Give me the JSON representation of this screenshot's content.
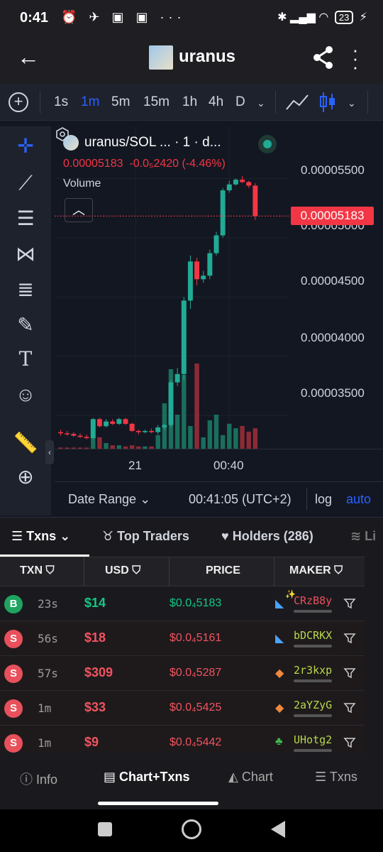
{
  "status_bar": {
    "time": "0:41",
    "battery": "23",
    "left_icons": "⏰ ✈ ▣ ▣ ···"
  },
  "header": {
    "title": "uranus"
  },
  "timeframes": {
    "items": [
      "1s",
      "1m",
      "5m",
      "15m",
      "1h",
      "4h",
      "D"
    ],
    "active": "1m"
  },
  "chart_legend": {
    "symbol": "uranus/SOL ... · 1 · d...",
    "last_price": "0.00005183",
    "change": "-0.0₅2420 (-4.46%)",
    "volume_label": "Volume"
  },
  "chart_data": {
    "type": "candlestick",
    "y_ticks": [
      "0.00005500",
      "0.00005000",
      "0.00004500",
      "0.00004000",
      "0.00003500"
    ],
    "y_range": [
      3.22e-05,
      5.7e-05
    ],
    "price_tag": "0.00005183",
    "x_ticks": [
      "21",
      "00:40"
    ],
    "candles": [
      {
        "o": 3.36e-05,
        "h": 3.38e-05,
        "l": 3.33e-05,
        "c": 3.35e-05,
        "v": 1
      },
      {
        "o": 3.35e-05,
        "h": 3.37e-05,
        "l": 3.33e-05,
        "c": 3.345e-05,
        "v": 1
      },
      {
        "o": 3.345e-05,
        "h": 3.36e-05,
        "l": 3.32e-05,
        "c": 3.33e-05,
        "v": 1
      },
      {
        "o": 3.33e-05,
        "h": 3.35e-05,
        "l": 3.31e-05,
        "c": 3.32e-05,
        "v": 1
      },
      {
        "o": 3.32e-05,
        "h": 3.34e-05,
        "l": 3.3e-05,
        "c": 3.31e-05,
        "v": 1
      },
      {
        "o": 3.31e-05,
        "h": 3.48e-05,
        "l": 3.3e-05,
        "c": 3.47e-05,
        "v": 25
      },
      {
        "o": 3.47e-05,
        "h": 3.48e-05,
        "l": 3.4e-05,
        "c": 3.41e-05,
        "v": 10
      },
      {
        "o": 3.41e-05,
        "h": 3.47e-05,
        "l": 3.4e-05,
        "c": 3.45e-05,
        "v": 5
      },
      {
        "o": 3.45e-05,
        "h": 3.47e-05,
        "l": 3.42e-05,
        "c": 3.43e-05,
        "v": 3
      },
      {
        "o": 3.43e-05,
        "h": 3.48e-05,
        "l": 3.42e-05,
        "c": 3.47e-05,
        "v": 3
      },
      {
        "o": 3.47e-05,
        "h": 3.48e-05,
        "l": 3.42e-05,
        "c": 3.43e-05,
        "v": 2
      },
      {
        "o": 3.43e-05,
        "h": 3.44e-05,
        "l": 3.36e-05,
        "c": 3.37e-05,
        "v": 3
      },
      {
        "o": 3.37e-05,
        "h": 3.38e-05,
        "l": 3.34e-05,
        "c": 3.36e-05,
        "v": 2
      },
      {
        "o": 3.36e-05,
        "h": 3.38e-05,
        "l": 3.35e-05,
        "c": 3.37e-05,
        "v": 2
      },
      {
        "o": 3.37e-05,
        "h": 3.39e-05,
        "l": 3.35e-05,
        "c": 3.36e-05,
        "v": 2
      },
      {
        "o": 3.36e-05,
        "h": 3.42e-05,
        "l": 3.34e-05,
        "c": 3.4e-05,
        "v": 12
      },
      {
        "o": 3.4e-05,
        "h": 3.43e-05,
        "l": 3.38e-05,
        "c": 3.42e-05,
        "v": 40
      },
      {
        "o": 3.42e-05,
        "h": 3.8e-05,
        "l": 3.4e-05,
        "c": 3.78e-05,
        "v": 70
      },
      {
        "o": 3.78e-05,
        "h": 3.9e-05,
        "l": 3.75e-05,
        "c": 3.85e-05,
        "v": 30
      },
      {
        "o": 3.85e-05,
        "h": 4.5e-05,
        "l": 3.8e-05,
        "c": 4.47e-05,
        "v": 65
      },
      {
        "o": 4.47e-05,
        "h": 4.85e-05,
        "l": 4.4e-05,
        "c": 4.8e-05,
        "v": 20
      },
      {
        "o": 4.8e-05,
        "h": 4.83e-05,
        "l": 4.6e-05,
        "c": 4.65e-05,
        "v": 75
      },
      {
        "o": 4.65e-05,
        "h": 4.72e-05,
        "l": 4.62e-05,
        "c": 4.68e-05,
        "v": 10
      },
      {
        "o": 4.68e-05,
        "h": 4.9e-05,
        "l": 4.65e-05,
        "c": 4.87e-05,
        "v": 25
      },
      {
        "o": 4.87e-05,
        "h": 5.05e-05,
        "l": 4.85e-05,
        "c": 5.02e-05,
        "v": 30
      },
      {
        "o": 5.02e-05,
        "h": 5.42e-05,
        "l": 5e-05,
        "c": 5.4e-05,
        "v": 12
      },
      {
        "o": 5.4e-05,
        "h": 5.48e-05,
        "l": 5.38e-05,
        "c": 5.45e-05,
        "v": 22
      },
      {
        "o": 5.45e-05,
        "h": 5.5e-05,
        "l": 5.44e-05,
        "c": 5.49e-05,
        "v": 18
      },
      {
        "o": 5.49e-05,
        "h": 5.52e-05,
        "l": 5.46e-05,
        "c": 5.47e-05,
        "v": 20
      },
      {
        "o": 5.47e-05,
        "h": 5.48e-05,
        "l": 5.42e-05,
        "c": 5.44e-05,
        "v": 15
      },
      {
        "o": 5.44e-05,
        "h": 5.46e-05,
        "l": 5.15e-05,
        "c": 5.183e-05,
        "v": 18
      }
    ],
    "up_color": "#22ab94",
    "down_color": "#f23645"
  },
  "chart_footer": {
    "date_range": "Date Range",
    "clock": "00:41:05 (UTC+2)",
    "log": "log",
    "auto": "auto"
  },
  "tabs": {
    "txns": "Txns",
    "top_traders": "Top Traders",
    "holders": "Holders (286)",
    "liquidity": "Li"
  },
  "table": {
    "headers": {
      "txn": "TXN",
      "usd": "USD",
      "price": "PRICE",
      "maker": "MAKER"
    },
    "rows": [
      {
        "type": "B",
        "age": "23s",
        "usd": "$14",
        "price": "$0.0₄5183",
        "maker": "CRzB8y",
        "icon": "✨"
      },
      {
        "type": "S",
        "age": "56s",
        "usd": "$18",
        "price": "$0.0₄5161",
        "maker": "bDCRKX",
        "icon": ""
      },
      {
        "type": "S",
        "age": "57s",
        "usd": "$309",
        "price": "$0.0₄5287",
        "maker": "2r3kxp",
        "icon": ""
      },
      {
        "type": "S",
        "age": "1m",
        "usd": "$33",
        "price": "$0.0₄5425",
        "maker": "2aYZyG",
        "icon": ""
      },
      {
        "type": "S",
        "age": "1m",
        "usd": "$9",
        "price": "$0.0₄5442",
        "maker": "UHotg2",
        "icon": ""
      }
    ],
    "buy_color": "#16c784",
    "sell_color": "#f0545f"
  },
  "bottom_nav": {
    "info": "Info",
    "chart_txns": "Chart+Txns",
    "chart": "Chart",
    "txns": "Txns"
  }
}
